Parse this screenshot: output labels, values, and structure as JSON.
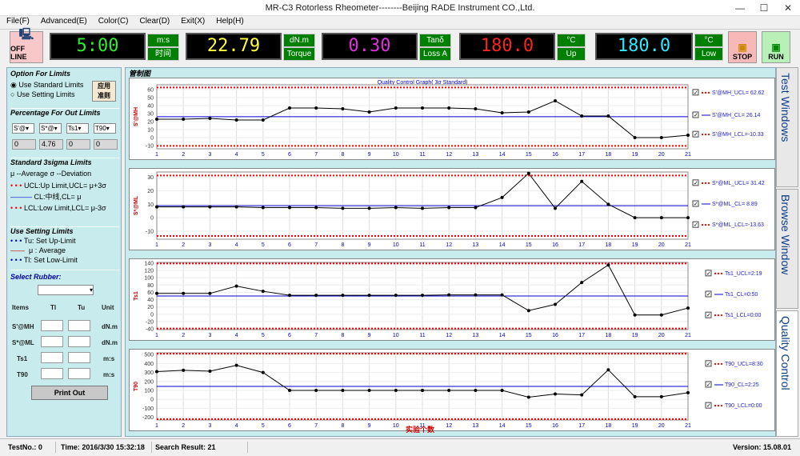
{
  "window": {
    "title": "MR-C3 Rotorless Rheometer--------Beijing RADE Instrument CO.,Ltd.",
    "min": "—",
    "max": "☐",
    "close": "✕"
  },
  "menu": [
    "File(F)",
    "Advanced(E)",
    "Color(C)",
    "Clear(D)",
    "Exit(X)",
    "Help(H)"
  ],
  "toolbar": {
    "offline": "OFF LINE",
    "time": {
      "value": "5:00",
      "unit1": "m:s",
      "unit2": "时间"
    },
    "torque": {
      "value": "22.79",
      "unit1": "dN.m",
      "unit2": "Torque"
    },
    "tan": {
      "value": "0.30",
      "unit1": "Tanδ",
      "unit2": "Loss A"
    },
    "up": {
      "value": "180.0",
      "unit1": "°C",
      "unit2": "Up"
    },
    "low": {
      "value": "180.0",
      "unit1": "°C",
      "unit2": "Low"
    },
    "stop": "STOP",
    "run": "RUN"
  },
  "left": {
    "opt_title": "Option For Limits",
    "opt_std": "Use Standard Limits",
    "opt_set": "Use Setting Limits",
    "apply_btn": "应用\n准则",
    "pct_title": "Percentage For Out Limits",
    "pct_selects": [
      "S'@",
      "S*@",
      "Ts1",
      "T90"
    ],
    "pct_values": [
      "0",
      "4.76",
      "0",
      "0"
    ],
    "std_title": "Standard 3sigma Limits",
    "std_mu": "μ --Average   σ --Deviation",
    "std_ucl": "UCL:Up Limit,UCL= μ+3σ",
    "std_cl": "CL:中线,CL= μ",
    "std_lcl": "LCL:Low Limit,LCL= μ-3σ",
    "set_title": "Use Setting Limits",
    "set_tu": "Tu: Set Up-Limit",
    "set_mu": "μ : Average",
    "set_tl": "Tl: Set Low-Limit",
    "rubber_label": "Select Rubber:",
    "hdr_items": "Items",
    "hdr_tl": "Tl",
    "hdr_tu": "Tu",
    "hdr_unit": "Unit",
    "rows": [
      {
        "item": "S'@MH",
        "unit": "dN.m"
      },
      {
        "item": "S*@ML",
        "unit": "dN.m"
      },
      {
        "item": "Ts1",
        "unit": "m:s"
      },
      {
        "item": "T90",
        "unit": "m:s"
      }
    ],
    "print": "Print Out"
  },
  "chart_area": {
    "title": "管制图",
    "graph_title": "Quality Control Graph( 3σ Standard)",
    "xlabel": "实验个数"
  },
  "chart_data": [
    {
      "type": "line",
      "ylabel": "S'@MH",
      "x": [
        1,
        2,
        3,
        4,
        5,
        6,
        7,
        8,
        9,
        10,
        11,
        12,
        13,
        14,
        15,
        16,
        17,
        18,
        19,
        20,
        21
      ],
      "values": [
        23,
        23,
        24,
        22,
        22,
        37,
        37,
        36,
        32,
        37,
        37,
        37,
        36,
        31,
        32,
        46,
        27,
        27,
        0,
        0,
        3
      ],
      "ucl": 62.62,
      "cl": 26.14,
      "lcl": -10.33,
      "ylim": [
        -14,
        66
      ],
      "yticks": [
        -10,
        0,
        10,
        20,
        30,
        40,
        50,
        60
      ],
      "legend": [
        "S'@MH_UCL= 62.62",
        "S'@MH_CL= 26.14",
        "S'@MH_LCL=-10.33"
      ]
    },
    {
      "type": "line",
      "ylabel": "S*@ML",
      "x": [
        1,
        2,
        3,
        4,
        5,
        6,
        7,
        8,
        9,
        10,
        11,
        12,
        13,
        14,
        15,
        16,
        17,
        18,
        19,
        20,
        21
      ],
      "values": [
        8,
        8,
        8,
        8,
        7.5,
        7.5,
        7.5,
        7,
        7,
        7.5,
        7,
        7.5,
        7.5,
        15,
        33,
        7,
        27,
        10,
        0,
        0,
        0
      ],
      "ucl": 31.42,
      "cl": 8.89,
      "lcl": -13.63,
      "ylim": [
        -16,
        34
      ],
      "yticks": [
        -10,
        0,
        10,
        20,
        30
      ],
      "legend": [
        "S*@ML_UCL= 31.42",
        "S*@ML_CL= 8.89",
        "S*@ML_LCL=-13.63"
      ]
    },
    {
      "type": "line",
      "ylabel": "Ts1",
      "x": [
        1,
        2,
        3,
        4,
        5,
        6,
        7,
        8,
        9,
        10,
        11,
        12,
        13,
        14,
        15,
        16,
        17,
        18,
        19,
        20,
        21
      ],
      "values": [
        57,
        57,
        57,
        77,
        63,
        52,
        52,
        52,
        52,
        52,
        52,
        53,
        53,
        53,
        10,
        27,
        87,
        135,
        -2,
        -2,
        17
      ],
      "ucl": 139,
      "cl": 50,
      "lcl": -39,
      "ylim": [
        -42,
        142
      ],
      "yticks": [
        -40,
        -20,
        0,
        20,
        40,
        60,
        80,
        100,
        120,
        140
      ],
      "legend": [
        "Ts1_UCL=2:19",
        "Ts1_CL=0:50",
        "Ts1_LCL=0:00"
      ]
    },
    {
      "type": "line",
      "ylabel": "T90",
      "x": [
        1,
        2,
        3,
        4,
        5,
        6,
        7,
        8,
        9,
        10,
        11,
        12,
        13,
        14,
        15,
        16,
        17,
        18,
        19,
        20,
        21
      ],
      "values": [
        310,
        325,
        315,
        380,
        300,
        100,
        100,
        100,
        100,
        100,
        100,
        100,
        100,
        100,
        25,
        60,
        50,
        330,
        30,
        30,
        75
      ],
      "ucl": 510,
      "cl": 145,
      "lcl": -220,
      "ylim": [
        -230,
        520
      ],
      "yticks": [
        -200,
        -100,
        0,
        100,
        200,
        300,
        400,
        500
      ],
      "legend": [
        "T90_UCL=8:30",
        "T90_CL=2:25",
        "T90_LCL=0:00"
      ]
    }
  ],
  "tabs": [
    "Test Windows",
    "Browse Window",
    "Quality Control"
  ],
  "status": {
    "test": "TestNo.: 0",
    "time": "Time: 2016/3/30 15:32:18",
    "search": "Search Result: 21",
    "version": "Version: 15.08.01"
  },
  "colors": {
    "panel_bg": "#c8ecee",
    "limit": "#ff0000",
    "center": "#0000c0",
    "unit_bg": "#008000"
  }
}
